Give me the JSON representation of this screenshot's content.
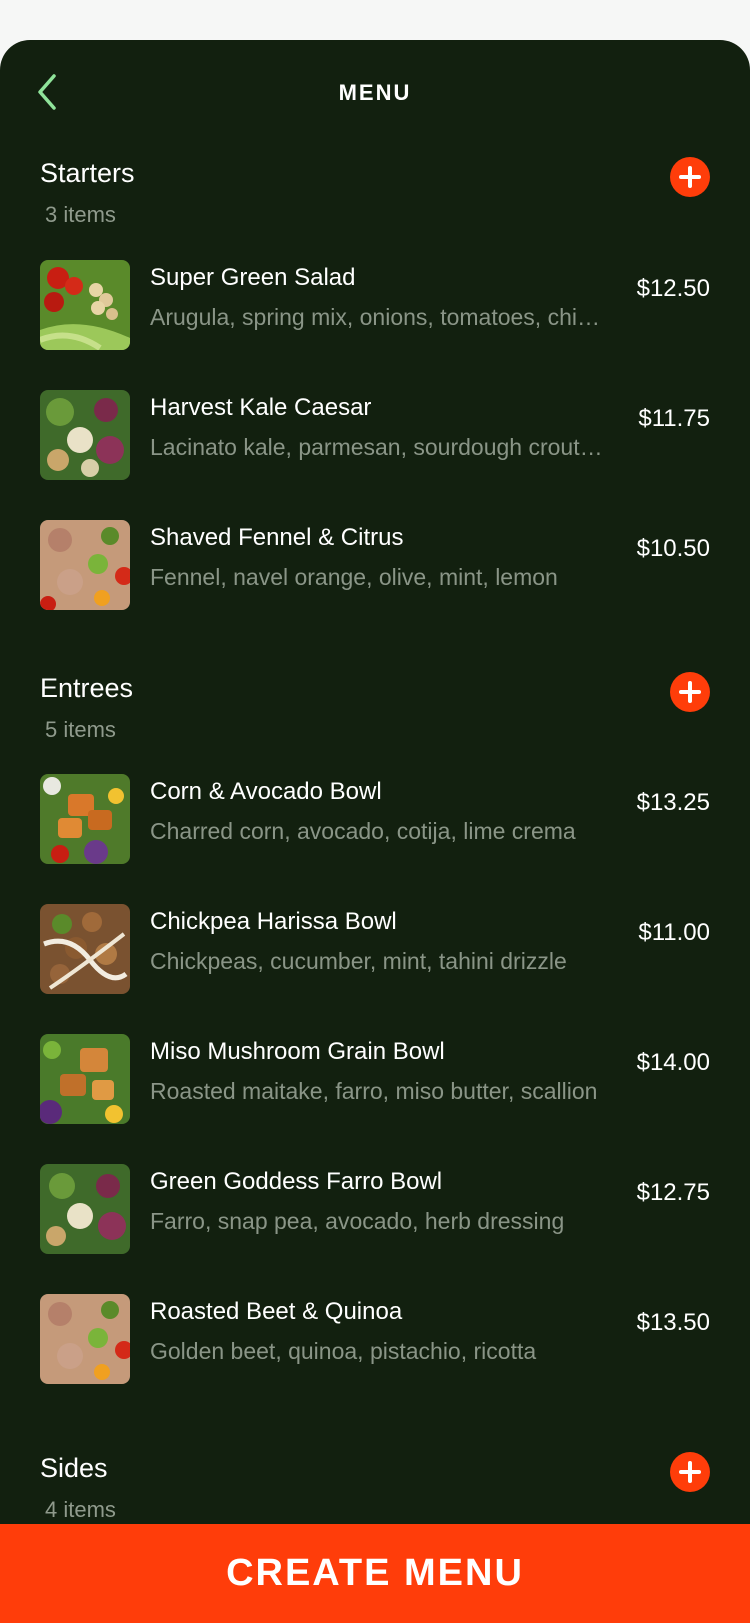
{
  "header": {
    "title": "MENU"
  },
  "sections": [
    {
      "title": "Starters",
      "count": "3 items",
      "items": [
        {
          "name": "Super Green Salad",
          "desc": "Arugula, spring mix, onions, tomatoes, chickpeas",
          "price": "$12.50"
        },
        {
          "name": "Harvest Kale Caesar",
          "desc": "Lacinato kale, parmesan, sourdough croutons",
          "price": "$11.75"
        },
        {
          "name": "Shaved Fennel & Citrus",
          "desc": "Fennel, navel orange, olive, mint, lemon",
          "price": "$10.50"
        }
      ]
    },
    {
      "title": "Entrees",
      "count": "5 items",
      "items": [
        {
          "name": "Corn & Avocado Bowl",
          "desc": "Charred corn, avocado, cotija, lime crema",
          "price": "$13.25"
        },
        {
          "name": "Chickpea Harissa Bowl",
          "desc": "Chickpeas, cucumber, mint, tahini drizzle",
          "price": "$11.00"
        },
        {
          "name": "Miso Mushroom Grain Bowl",
          "desc": "Roasted maitake, farro, miso butter, scallion",
          "price": "$14.00"
        },
        {
          "name": "Green Goddess Farro Bowl",
          "desc": "Farro, snap pea, avocado, herb dressing",
          "price": "$12.75"
        },
        {
          "name": "Roasted Beet & Quinoa",
          "desc": "Golden beet, quinoa, pistachio, ricotta",
          "price": "$13.50"
        }
      ]
    },
    {
      "title": "Sides",
      "count": "4 items",
      "items": []
    }
  ],
  "cta": {
    "label": "CREATE MENU"
  },
  "colors": {
    "background": "#12200f",
    "accent": "#ff3d0a",
    "back_icon": "#8fe39a",
    "muted_text": "#8a9587"
  }
}
